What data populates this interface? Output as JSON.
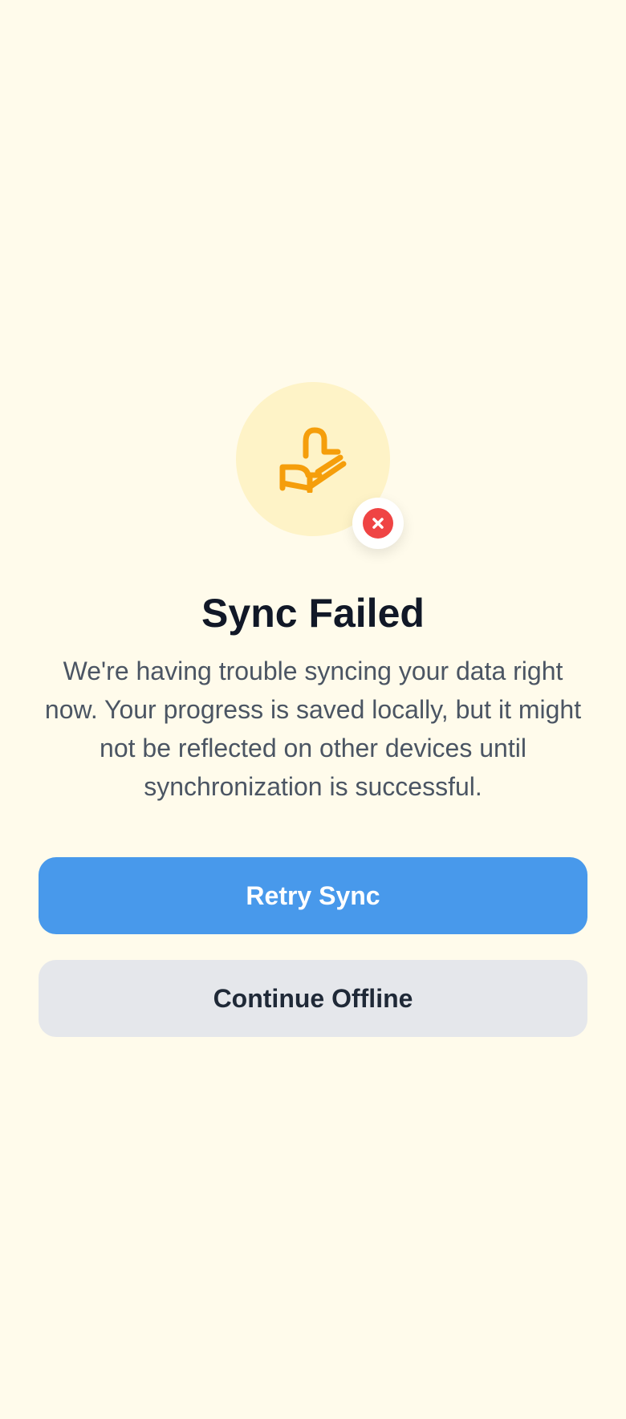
{
  "status": {
    "title": "Sync Failed",
    "message": "We're having trouble syncing your data right now. Your progress is saved locally, but it might not be reflected on other devices until synchronization is successful.",
    "icon": "hand-sync-icon",
    "badge_icon": "error-x-icon"
  },
  "actions": {
    "primary_label": "Retry Sync",
    "secondary_label": "Continue Offline"
  },
  "colors": {
    "background": "#fffbeb",
    "icon_bg": "#fef3c7",
    "icon": "#f59e0b",
    "error": "#ef4444",
    "primary": "#4899eb",
    "secondary": "#e5e7eb"
  }
}
